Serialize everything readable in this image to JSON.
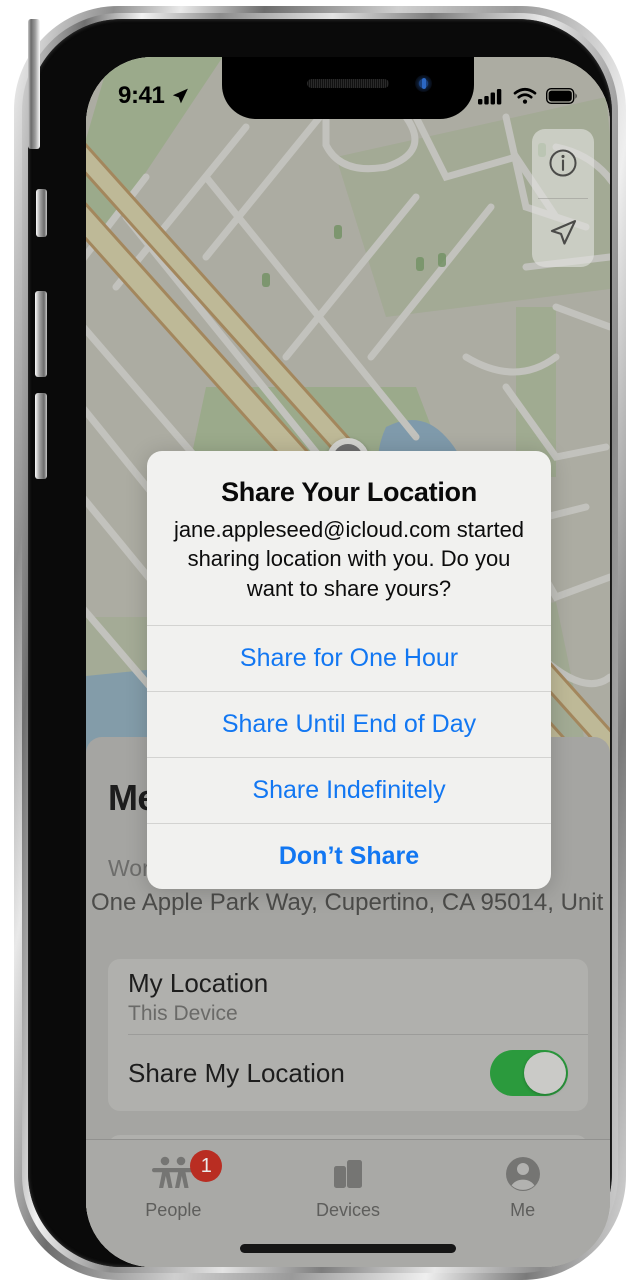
{
  "device": {
    "kind": "iphone-x"
  },
  "status_bar": {
    "time": "9:41",
    "location_arrow_icon": "location-arrow-icon",
    "cellular_icon": "cellular-bars-icon",
    "wifi_icon": "wifi-icon",
    "battery_icon": "battery-full-icon"
  },
  "map": {
    "info_button_icon": "info-circle-icon",
    "tracking_button_icon": "location-arrow-icon",
    "marker_icon": "map-pin-dot",
    "colors": {
      "land": "#c3c2b6",
      "park": "#a8bf93",
      "water": "#7fa8c4",
      "road": "#e2e2dd",
      "highway": "#ded7a6",
      "highway_border": "#b58a4e"
    }
  },
  "sheet": {
    "title": "Me",
    "address_label": "Work",
    "address_value": "One Apple Park Way, Cupertino, CA 95014, Unit…",
    "rows": [
      {
        "title": "My Location",
        "subtitle": "This Device",
        "has_toggle": false
      },
      {
        "title": "Share My Location",
        "subtitle": "",
        "has_toggle": true,
        "toggle_on": true
      }
    ],
    "second_card_toggle_on": true
  },
  "tab_bar": {
    "tabs": [
      {
        "label": "People",
        "icon": "people-icon",
        "badge": "1"
      },
      {
        "label": "Devices",
        "icon": "devices-icon",
        "badge": ""
      },
      {
        "label": "Me",
        "icon": "person-circle-icon",
        "badge": ""
      }
    ]
  },
  "alert": {
    "title": "Share Your Location",
    "message": "jane.appleseed@icloud.com started sharing location with you. Do you want to share yours?",
    "buttons": [
      {
        "label": "Share for One Hour",
        "bold": false
      },
      {
        "label": "Share Until End of Day",
        "bold": false
      },
      {
        "label": "Share Indefinitely",
        "bold": false
      },
      {
        "label": "Don’t Share",
        "bold": true
      }
    ],
    "tint": "#1277f2"
  },
  "colors": {
    "toggle_on": "#2b9a3d",
    "badge_red": "#b92d22",
    "accent_blue": "#1277f2"
  }
}
